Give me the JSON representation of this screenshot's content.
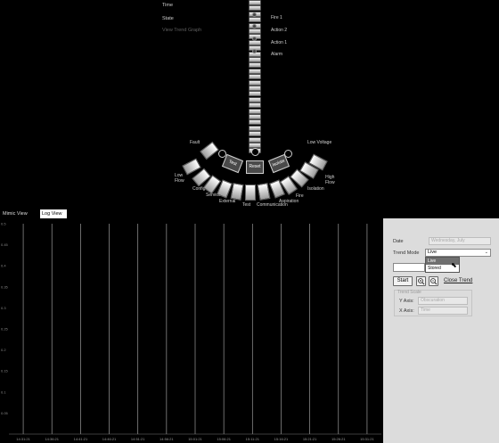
{
  "mimic": {
    "info": {
      "time_label": "Time",
      "state_label": "State",
      "view_trend_graph_link": "View Trend Graph"
    },
    "column_labels": [
      "Fire 1",
      "Action 2",
      "Action 1",
      "Alarm"
    ],
    "side_labels": {
      "fault": "Fault",
      "low_voltage": "Low Voltage",
      "low_flow": "Low\nFlow",
      "high_flow": "High\nFlow",
      "config": "Config",
      "isolation": "Isolation",
      "service": "Service",
      "fire": "Fire",
      "external": "External",
      "test": "Test",
      "communication": "Communication",
      "aspiration": "Aspiration"
    },
    "center_buttons": [
      "Test",
      "Reset",
      "Isolate"
    ]
  },
  "tabs": {
    "mimic_view": "Mimic View",
    "log_view": "Log View"
  },
  "panel": {
    "date_label": "Date",
    "date_value": "Wednesday, July",
    "trend_mode_label": "Trend Mode",
    "trend_mode_value": "Live",
    "trend_mode_options": [
      "Live",
      "Stored"
    ],
    "start_button": "Start",
    "zoom_in_icon": "zoom-in-icon",
    "zoom_out_icon": "zoom-out-icon",
    "close_trend_link": "Close Trend",
    "trend_scale_title": "Trend Scale",
    "y_axis_label": "Y Axis:",
    "y_axis_value": "Obscuration",
    "x_axis_label": "X Axis:",
    "x_axis_value": "Time"
  },
  "chart_data": {
    "type": "line",
    "title": "",
    "xlabel": "",
    "ylabel": "",
    "x_tick_labels": [
      "14:31:21",
      "14:36:21",
      "14:41:21",
      "14:46:21",
      "14:51:21",
      "14:56:21",
      "15:01:21",
      "15:06:21",
      "15:11:21",
      "15:16:21",
      "15:21:21",
      "15:26:21",
      "15:31:21"
    ],
    "y_tick_labels": [
      "0.5",
      "0.45",
      "0.4",
      "0.35",
      "0.3",
      "0.25",
      "0.2",
      "0.15",
      "0.1",
      "0.05"
    ],
    "ylim": [
      0,
      0.5
    ],
    "grid": true,
    "series": []
  }
}
